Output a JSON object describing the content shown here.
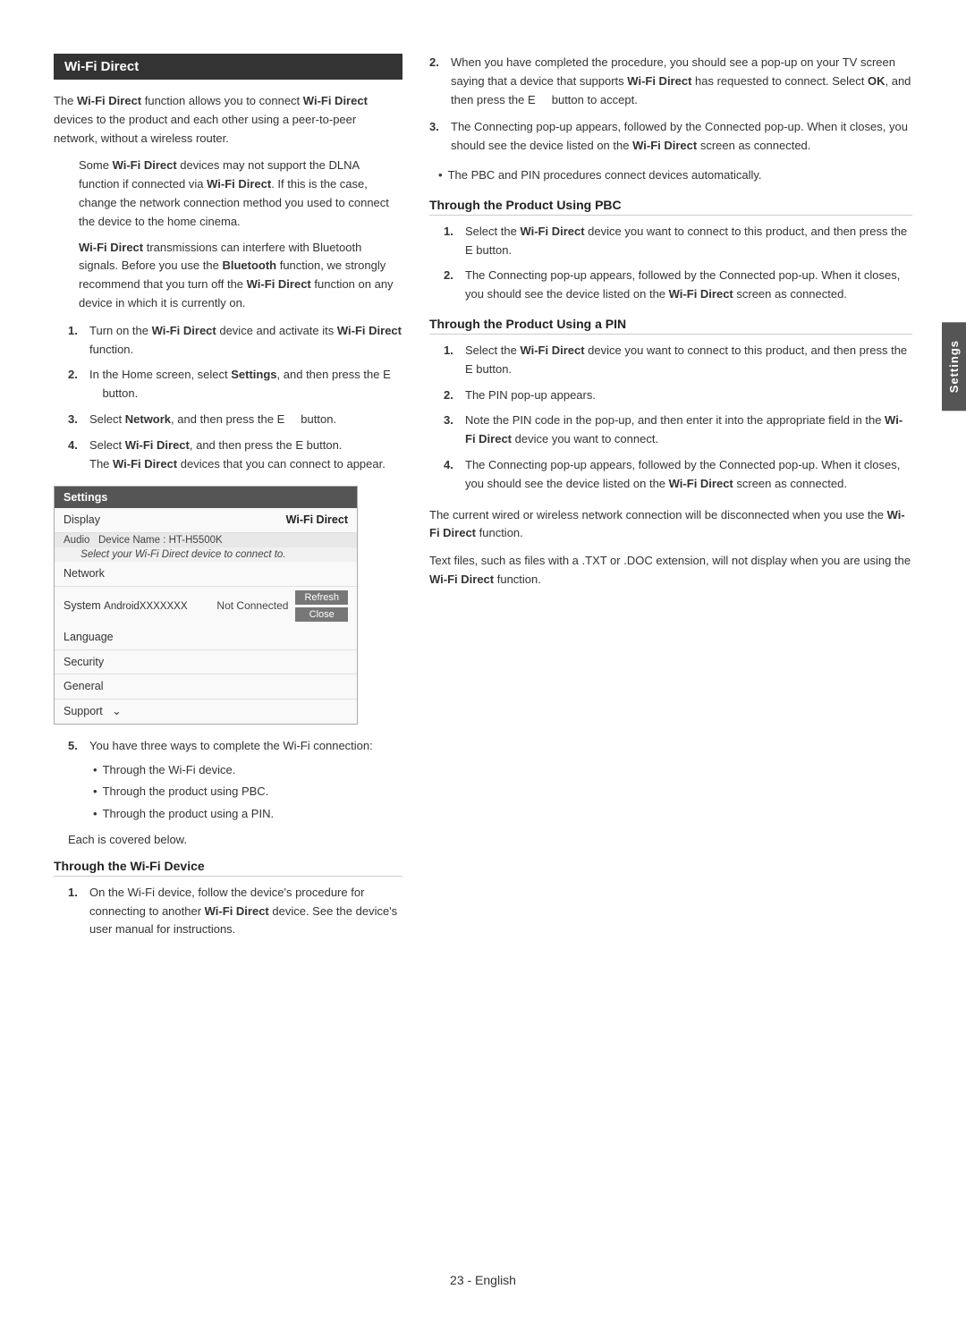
{
  "page": {
    "footer": "23  -  English"
  },
  "side_tab": {
    "label": "Settings"
  },
  "section": {
    "title": "Wi-Fi Direct"
  },
  "left_column": {
    "intro_p1": "The Wi-Fi Direct function allows you to connect Wi-Fi Direct devices to the product and each other using a peer-to-peer network, without a wireless router.",
    "indented_p1": "Some Wi-Fi Direct devices may not support the DLNA function if connected via Wi-Fi Direct. If this is the case, change the network connection method you used to connect the device to the home cinema.",
    "indented_p2_first": "Wi-Fi Direct transmissions can interfere with Bluetooth signals. Before you use the Bluetooth function, we strongly recommend that you turn off the Wi-Fi Direct function on any device in which it is currently on.",
    "numbered_items": [
      {
        "num": "1.",
        "text": "Turn on the Wi-Fi Direct device and activate its Wi-Fi Direct function."
      },
      {
        "num": "2.",
        "text": "In the Home screen, select Settings, and then press the E     button."
      },
      {
        "num": "3.",
        "text": "Select Network, and then press the E    button."
      },
      {
        "num": "4.",
        "text": "Select Wi-Fi Direct, and then press the E button.\nThe Wi-Fi Direct devices that you can connect to appear."
      }
    ],
    "settings_box": {
      "header": "Settings",
      "rows": [
        {
          "label": "Display",
          "value": "Wi-Fi Direct",
          "type": "normal"
        },
        {
          "label": "Audio",
          "sub": "Device Name : HT-H5500K",
          "type": "device"
        },
        {
          "label": "",
          "sub": "Select your Wi-Fi Direct device to connect to.",
          "type": "prompt"
        },
        {
          "label": "Network",
          "type": "normal"
        },
        {
          "label": "System",
          "sub": "AndroidXXXXXXX",
          "value": "Not Connected",
          "type": "android"
        },
        {
          "label": "Language",
          "type": "normal"
        },
        {
          "label": "Security",
          "type": "normal"
        },
        {
          "label": "General",
          "type": "normal"
        },
        {
          "label": "Support",
          "type": "normal"
        }
      ],
      "button_refresh": "Refresh",
      "button_close": "Close"
    },
    "step5_intro": "You have three ways to complete the Wi-Fi connection:",
    "step5_bullets": [
      "Through the Wi-Fi device.",
      "Through the product using PBC.",
      "Through the product using a PIN."
    ],
    "step5_note": "Each is covered below.",
    "through_wifi_title": "Through the Wi-Fi Device",
    "through_wifi_numbered": [
      {
        "num": "1.",
        "text": "On the Wi-Fi device, follow the device's procedure for connecting to another Wi-Fi Direct device. See the device's user manual for instructions."
      }
    ]
  },
  "right_column": {
    "step2_text": "When you have completed the procedure, you should see a pop-up on your TV screen saying that a device that supports Wi-Fi Direct has requested to connect. Select OK, and then press the E    button to accept.",
    "step3_text": "The Connecting pop-up appears, followed by the Connected pop-up. When it closes, you should see the device listed on the Wi-Fi Direct screen as connected.",
    "pbc_bullet": "The PBC and PIN procedures connect devices automatically.",
    "through_pbc_title": "Through the Product Using PBC",
    "through_pbc_numbered": [
      {
        "num": "1.",
        "text": "Select the Wi-Fi Direct device you want to connect to this product, and then press the E button."
      },
      {
        "num": "2.",
        "text": "The Connecting pop-up appears, followed by the Connected pop-up. When it closes, you should see the device listed on the Wi-Fi Direct screen as connected."
      }
    ],
    "through_pin_title": "Through the Product Using a PIN",
    "through_pin_numbered": [
      {
        "num": "1.",
        "text": "Select the Wi-Fi Direct device you want to connect to this product, and then press the E button."
      },
      {
        "num": "2.",
        "text": "The PIN pop-up appears."
      },
      {
        "num": "3.",
        "text": "Note the PIN code in the pop-up, and then enter it into the appropriate field in the Wi-Fi Direct device you want to connect."
      },
      {
        "num": "4.",
        "text": "The Connecting pop-up appears, followed by the Connected pop-up. When it closes, you should see the device listed on the Wi-Fi Direct screen as connected."
      }
    ],
    "note_wired": "The current wired or wireless network connection will be disconnected when you use the Wi-Fi Direct function.",
    "note_text": "Text files, such as files with a .TXT or .DOC extension, will not display when you are using the Wi-Fi Direct function."
  }
}
